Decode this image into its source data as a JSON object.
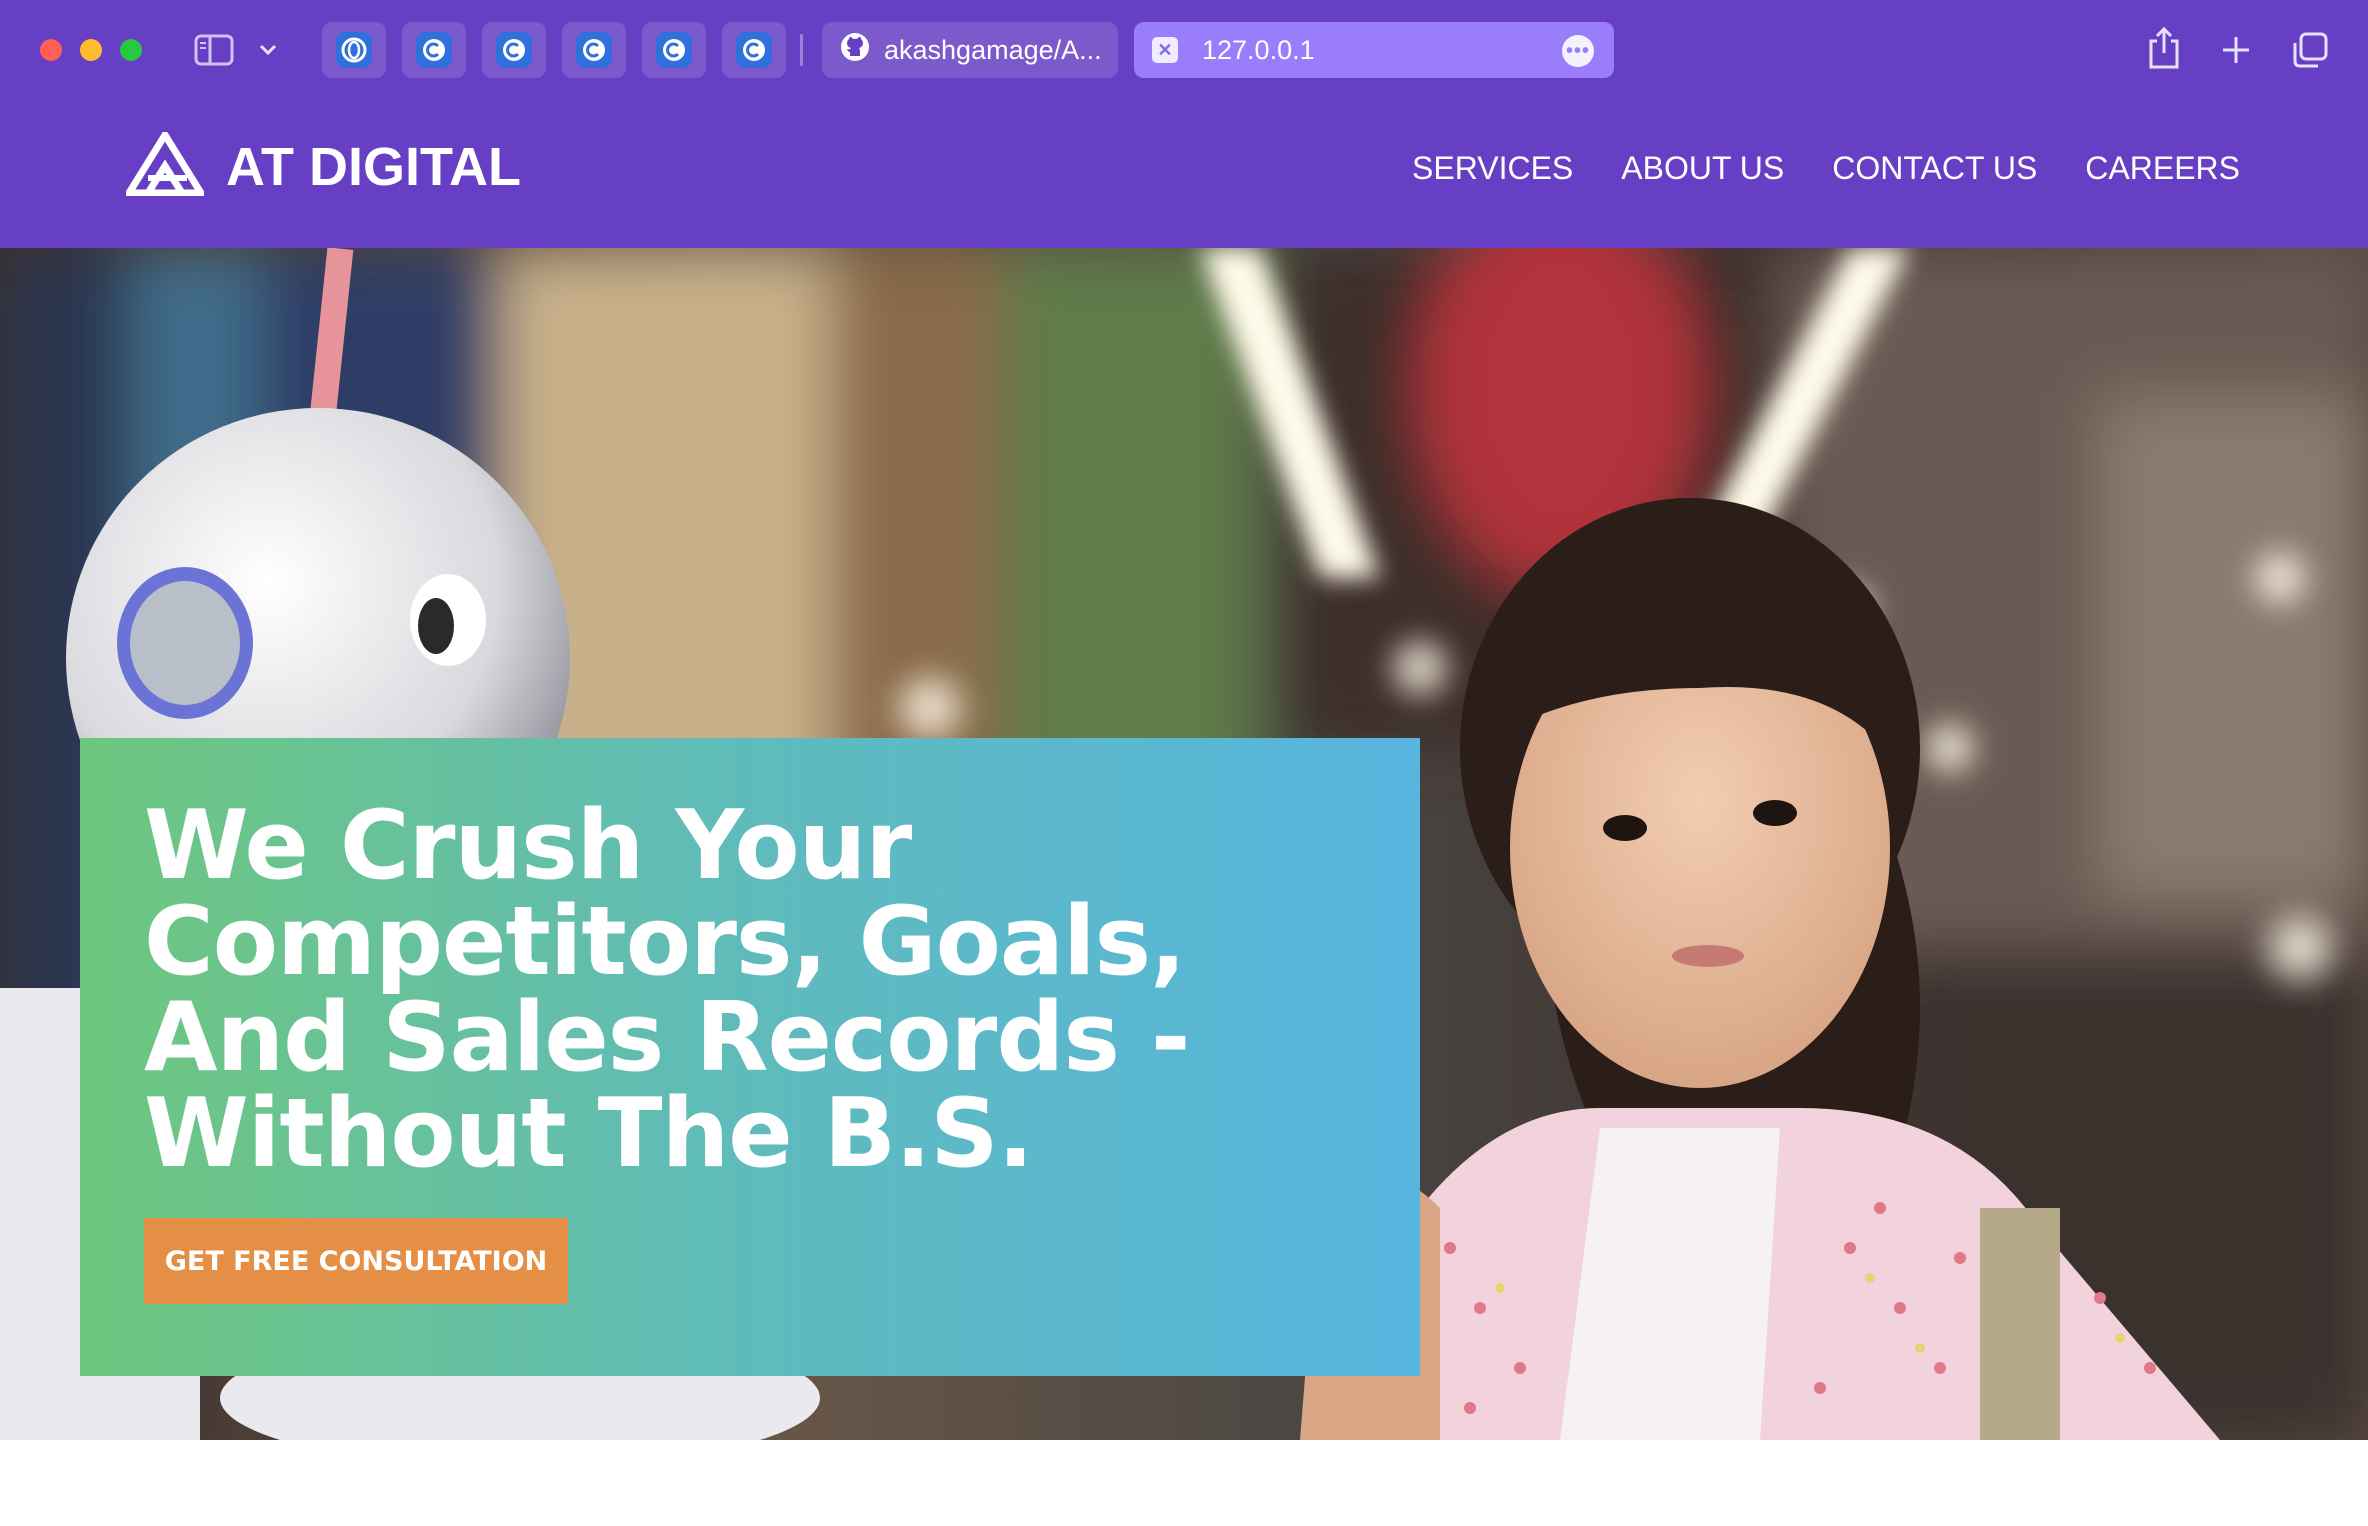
{
  "browser": {
    "pinned_tabs": [
      {
        "icon": "opera-icon"
      },
      {
        "icon": "c-icon"
      },
      {
        "icon": "c-icon"
      },
      {
        "icon": "c-icon"
      },
      {
        "icon": "c-icon"
      },
      {
        "icon": "c-icon"
      }
    ],
    "tabs": [
      {
        "icon": "github-icon",
        "label": "akashgamage/A..."
      },
      {
        "icon": "close-icon",
        "label": "127.0.0.1",
        "active": true
      }
    ]
  },
  "site": {
    "logo_text": "AT DIGITAL",
    "nav": [
      "SERVICES",
      "ABOUT US",
      "CONTACT US",
      "CAREERS"
    ]
  },
  "hero": {
    "title": "We Crush Your Competitors, Goals, And Sales Records - Without The B.S.",
    "cta_label": "GET FREE CONSULTATION"
  },
  "colors": {
    "brand_purple": "#673fc4",
    "cta_orange": "#e58e46",
    "card_gradient_start": "#6ec77d",
    "card_gradient_end": "#57b5e0"
  }
}
